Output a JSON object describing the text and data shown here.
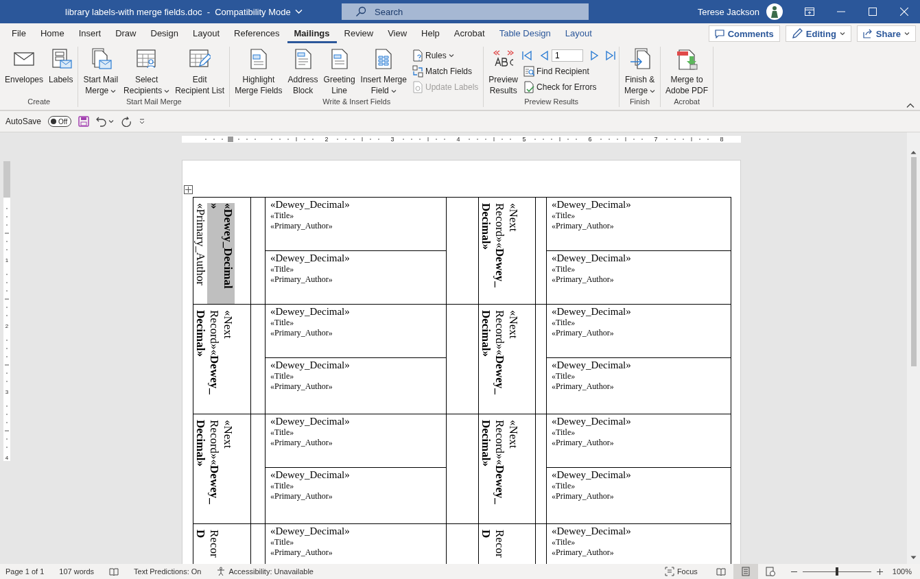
{
  "title_bar": {
    "title": "library labels-with merge fields.doc  -  Compatibility Mode",
    "search": "Search",
    "user": "Terese Jackson"
  },
  "menu_tabs": [
    {
      "label": "File",
      "selected": false,
      "kind": "standard"
    },
    {
      "label": "Home",
      "selected": false,
      "kind": "standard"
    },
    {
      "label": "Insert",
      "selected": false,
      "kind": "standard"
    },
    {
      "label": "Draw",
      "selected": false,
      "kind": "standard"
    },
    {
      "label": "Design",
      "selected": false,
      "kind": "standard"
    },
    {
      "label": "Layout",
      "selected": false,
      "kind": "standard"
    },
    {
      "label": "References",
      "selected": false,
      "kind": "standard"
    },
    {
      "label": "Mailings",
      "selected": true,
      "kind": "standard"
    },
    {
      "label": "Review",
      "selected": false,
      "kind": "standard"
    },
    {
      "label": "View",
      "selected": false,
      "kind": "standard"
    },
    {
      "label": "Help",
      "selected": false,
      "kind": "standard"
    },
    {
      "label": "Acrobat",
      "selected": false,
      "kind": "standard"
    },
    {
      "label": "Table Design",
      "selected": false,
      "kind": "contextual"
    },
    {
      "label": "Layout",
      "selected": false,
      "kind": "contextual"
    }
  ],
  "ribbon_actions": [
    {
      "label": "Comments",
      "dropdown": false
    },
    {
      "label": "Editing",
      "dropdown": true
    },
    {
      "label": "Share",
      "dropdown": true
    }
  ],
  "ribbon_groups": [
    {
      "label": "Create",
      "items": [
        {
          "kind": "large",
          "lines": [
            "Envelopes"
          ],
          "dropdown": false
        },
        {
          "kind": "large",
          "lines": [
            "Labels"
          ],
          "dropdown": false
        }
      ]
    },
    {
      "label": "Start Mail Merge",
      "items": [
        {
          "kind": "large",
          "lines": [
            "Start Mail",
            "Merge"
          ],
          "dropdown": true
        },
        {
          "kind": "large",
          "lines": [
            "Select",
            "Recipients"
          ],
          "dropdown": true
        },
        {
          "kind": "large",
          "lines": [
            "Edit",
            "Recipient List"
          ],
          "dropdown": false
        }
      ]
    },
    {
      "label": "Write & Insert Fields",
      "items": [
        {
          "kind": "large",
          "lines": [
            "Highlight",
            "Merge Fields"
          ],
          "dropdown": false
        },
        {
          "kind": "large",
          "lines": [
            "Address",
            "Block"
          ],
          "dropdown": false
        },
        {
          "kind": "large",
          "lines": [
            "Greeting",
            "Line"
          ],
          "dropdown": false
        },
        {
          "kind": "large",
          "lines": [
            "Insert Merge",
            "Field"
          ],
          "dropdown": true
        },
        {
          "kind": "small",
          "lines": [
            "Rules"
          ],
          "dropdown": true,
          "disabled": false
        },
        {
          "kind": "small",
          "lines": [
            "Match Fields"
          ],
          "dropdown": false,
          "disabled": false
        },
        {
          "kind": "small",
          "lines": [
            "Update Labels"
          ],
          "dropdown": false,
          "disabled": true
        }
      ]
    },
    {
      "label": "Preview Results",
      "items": [
        {
          "kind": "large",
          "lines": [
            "Preview",
            "Results"
          ],
          "dropdown": false
        },
        {
          "kind": "nav",
          "value": "1"
        },
        {
          "kind": "small",
          "lines": [
            "Find Recipient"
          ],
          "dropdown": false,
          "disabled": false
        },
        {
          "kind": "small",
          "lines": [
            "Check for Errors"
          ],
          "dropdown": false,
          "disabled": false
        }
      ]
    },
    {
      "label": "Finish",
      "items": [
        {
          "kind": "large",
          "lines": [
            "Finish &",
            "Merge"
          ],
          "dropdown": true
        }
      ]
    },
    {
      "label": "Acrobat",
      "items": [
        {
          "kind": "large",
          "lines": [
            "Merge to",
            "Adobe PDF"
          ],
          "dropdown": false
        }
      ]
    }
  ],
  "quick_access": {
    "autosave_label": "AutoSave",
    "autosave": {
      "on": false,
      "label": "Off"
    }
  },
  "ruler": {
    "marks": [
      "2",
      "3",
      "4",
      "5",
      "6",
      "7",
      "8"
    ]
  },
  "vertical_ruler": {
    "marks": [
      "1",
      "2",
      "3",
      "4"
    ]
  },
  "document": {
    "rows": [
      {
        "cells": [
          {
            "lines": [
              {
                "text": "«Dewey_Decimal",
                "bold": true,
                "highlighted": true
              },
              {
                "text": "»",
                "bold": true,
                "highlighted": true
              },
              {
                "text": "«Primary_Author",
                "bold": false,
                "highlighted": false
              }
            ],
            "labels": [
              {
                "heading": "«Dewey_Decimal»",
                "title": "«Title»",
                "author": "«Primary_Author»"
              },
              {
                "heading": "«Dewey_Decimal»",
                "title": "«Title»",
                "author": "«Primary_Author»"
              }
            ]
          },
          {
            "lines": [
              {
                "text": "«Next",
                "bold": false,
                "highlighted": false
              },
              {
                "text": "Record»«**Dewey_**",
                "bold": false,
                "highlighted": false
              },
              {
                "text": "Decimal»",
                "bold": true,
                "highlighted": false
              }
            ],
            "labels": [
              {
                "heading": "«Dewey_Decimal»",
                "title": "«Title»",
                "author": "«Primary_Author»"
              },
              {
                "heading": "«Dewey_Decimal»",
                "title": "«Title»",
                "author": "«Primary_Author»"
              }
            ]
          }
        ]
      },
      {
        "cells": [
          {
            "lines": [
              {
                "text": "«Next",
                "bold": false,
                "highlighted": false
              },
              {
                "text": "Record»«**Dewey_**",
                "bold": false,
                "highlighted": false
              },
              {
                "text": "Decimal»",
                "bold": true,
                "highlighted": false
              }
            ],
            "labels": [
              {
                "heading": "«Dewey_Decimal»",
                "title": "«Title»",
                "author": "«Primary_Author»"
              },
              {
                "heading": "«Dewey_Decimal»",
                "title": "«Title»",
                "author": "«Primary_Author»"
              }
            ]
          },
          {
            "lines": [
              {
                "text": "«Next",
                "bold": false,
                "highlighted": false
              },
              {
                "text": "Record»«**Dewey_**",
                "bold": false,
                "highlighted": false
              },
              {
                "text": "Decimal»",
                "bold": true,
                "highlighted": false
              }
            ],
            "labels": [
              {
                "heading": "«Dewey_Decimal»",
                "title": "«Title»",
                "author": "«Primary_Author»"
              },
              {
                "heading": "«Dewey_Decimal»",
                "title": "«Title»",
                "author": "«Primary_Author»"
              }
            ]
          }
        ]
      },
      {
        "cells": [
          {
            "lines": [
              {
                "text": "«Next",
                "bold": false,
                "highlighted": false
              },
              {
                "text": "Record»«**Dewey_**",
                "bold": false,
                "highlighted": false
              },
              {
                "text": "Decimal»",
                "bold": true,
                "highlighted": false
              }
            ],
            "labels": [
              {
                "heading": "«Dewey_Decimal»",
                "title": "«Title»",
                "author": "«Primary_Author»"
              },
              {
                "heading": "«Dewey_Decimal»",
                "title": "«Title»",
                "author": "«Primary_Author»"
              }
            ]
          },
          {
            "lines": [
              {
                "text": "«Next",
                "bold": false,
                "highlighted": false
              },
              {
                "text": "Record»«**Dewey_**",
                "bold": false,
                "highlighted": false
              },
              {
                "text": "Decimal»",
                "bold": true,
                "highlighted": false
              }
            ],
            "labels": [
              {
                "heading": "«Dewey_Decimal»",
                "title": "«Title»",
                "author": "«Primary_Author»"
              },
              {
                "heading": "«Dewey_Decimal»",
                "title": "«Title»",
                "author": "«Primary_Author»"
              }
            ]
          }
        ]
      },
      {
        "cells": [
          {
            "lines": [
              {
                "text": "Recor",
                "bold": false,
                "highlighted": false
              },
              {
                "text": "D",
                "bold": true,
                "highlighted": false
              }
            ],
            "labels": [
              {
                "heading": "«Dewey_Decimal»",
                "title": "«Title»",
                "author": "«Primary_Author»"
              }
            ]
          },
          {
            "lines": [
              {
                "text": "Recor",
                "bold": false,
                "highlighted": false
              },
              {
                "text": "D",
                "bold": true,
                "highlighted": false
              }
            ],
            "labels": [
              {
                "heading": "«Dewey_Decimal»",
                "title": "«Title»",
                "author": "«Primary_Author»"
              }
            ]
          }
        ]
      }
    ]
  },
  "status_bar": {
    "page": "Page 1 of 1",
    "words": "107 words",
    "text_predictions": "Text Predictions: On",
    "accessibility": "Accessibility: Unavailable",
    "focus": "Focus",
    "views": [
      {
        "kind": "read",
        "selected": false
      },
      {
        "kind": "print",
        "selected": true
      },
      {
        "kind": "web",
        "selected": false
      }
    ],
    "zoom": {
      "level": 0.5,
      "reading": "100%"
    }
  }
}
